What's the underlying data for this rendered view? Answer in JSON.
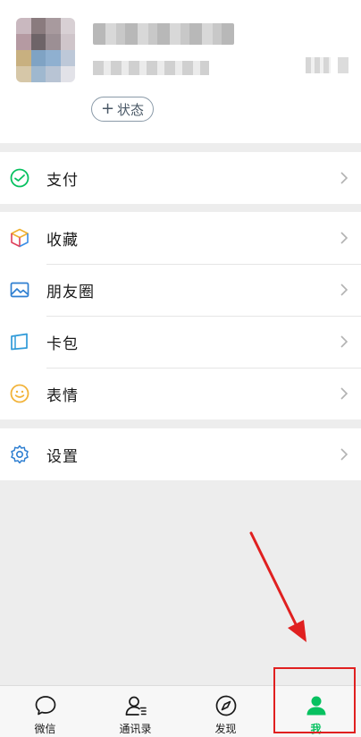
{
  "profile": {
    "status_label": "状态",
    "status_plus": "+"
  },
  "menu": {
    "pay": {
      "label": "支付",
      "icon": "wallet-icon"
    },
    "favorites": {
      "label": "收藏",
      "icon": "cube-icon"
    },
    "moments": {
      "label": "朋友圈",
      "icon": "image-icon"
    },
    "cards": {
      "label": "卡包",
      "icon": "card-icon"
    },
    "stickers": {
      "label": "表情",
      "icon": "smiley-icon"
    },
    "settings": {
      "label": "设置",
      "icon": "gear-icon"
    }
  },
  "tabs": [
    {
      "label": "微信",
      "icon": "chat-bubble-icon"
    },
    {
      "label": "通讯录",
      "icon": "contacts-icon"
    },
    {
      "label": "发现",
      "icon": "compass-icon"
    },
    {
      "label": "我",
      "icon": "person-icon",
      "active": true
    }
  ],
  "colors": {
    "accent": "#07c160",
    "annotation": "#e02020"
  }
}
